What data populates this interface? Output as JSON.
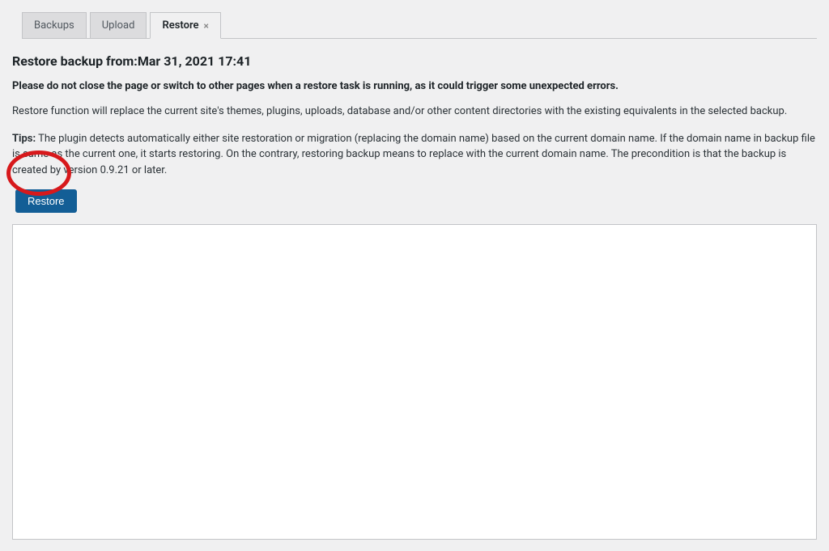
{
  "tabs": {
    "backups": "Backups",
    "upload": "Upload",
    "restore": "Restore"
  },
  "heading_prefix": "Restore backup from:",
  "heading_date": "Mar 31, 2021 17:41",
  "warning": "Please do not close the page or switch to other pages when a restore task is running, as it could trigger some unexpected errors.",
  "desc1": "Restore function will replace the current site's themes, plugins, uploads, database and/or other content directories with the existing equivalents in the selected backup.",
  "tips_label": "Tips:",
  "tips_text": " The plugin detects automatically either site restoration or migration (replacing the domain name) based on the current domain name. If the domain name in backup file is same as the current one, it starts restoring. On the contrary, restoring backup means to replace with the current domain name. The precondition is that the backup is created by version 0.9.21 or later.",
  "restore_button": "Restore"
}
